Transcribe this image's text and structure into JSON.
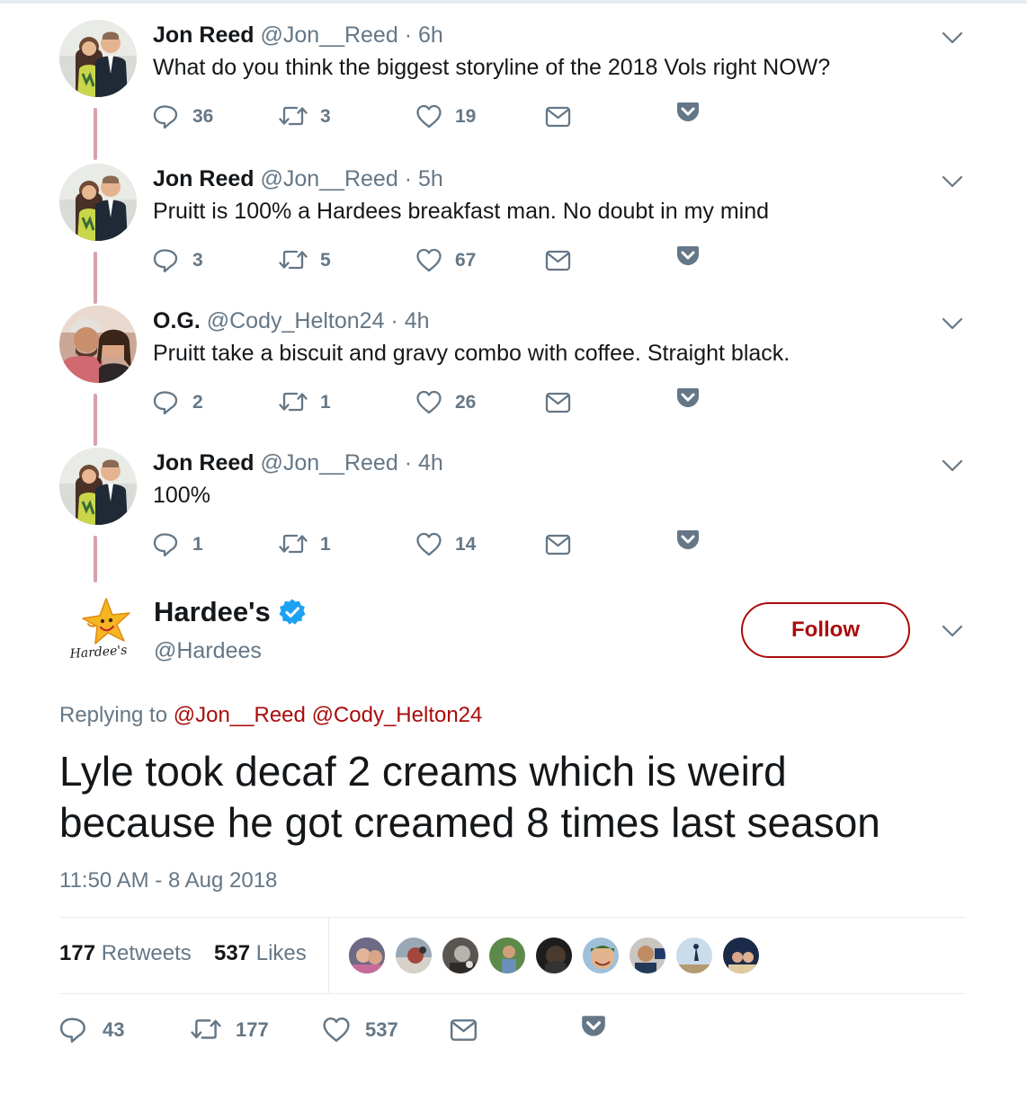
{
  "thread": [
    {
      "name": "Jon Reed",
      "handle": "@Jon__Reed",
      "separator": "·",
      "time": "6h",
      "text": "What do you think the biggest storyline of the 2018 Vols right NOW?",
      "replies": "36",
      "retweets": "3",
      "likes": "19"
    },
    {
      "name": "Jon Reed",
      "handle": "@Jon__Reed",
      "separator": "·",
      "time": "5h",
      "text": "Pruitt is 100% a Hardees breakfast man. No doubt in my mind",
      "replies": "3",
      "retweets": "5",
      "likes": "67"
    },
    {
      "name": "O.G.",
      "handle": "@Cody_Helton24",
      "separator": "·",
      "time": "4h",
      "text": "Pruitt take a biscuit and gravy combo with coffee. Straight black.",
      "replies": "2",
      "retweets": "1",
      "likes": "26"
    },
    {
      "name": "Jon Reed",
      "handle": "@Jon__Reed",
      "separator": "·",
      "time": "4h",
      "text": "100%",
      "replies": "1",
      "retweets": "1",
      "likes": "14"
    }
  ],
  "main": {
    "logo_text": "Hardee's",
    "name": "Hardee's",
    "handle": "@Hardees",
    "follow_label": "Follow",
    "replying_prefix": "Replying to",
    "replying_to_1": "@Jon__Reed",
    "replying_to_2": "@Cody_Helton24",
    "text_line_1": "Lyle took decaf 2 creams which is weird",
    "text_line_2": "because he got creamed 8 times last season",
    "timestamp": "11:50 AM - 8 Aug 2018",
    "retweets_count": "177",
    "retweets_label": "Retweets",
    "likes_count": "537",
    "likes_label": "Likes",
    "replies": "43",
    "retweets": "177",
    "likes": "537"
  },
  "colors": {
    "accent": "#aa0c0c",
    "muted": "#657786",
    "thread_line": "#d4a4a8",
    "verified": "#1da1f2"
  },
  "icons": [
    "reply-icon",
    "retweet-icon",
    "like-icon",
    "direct-message-icon",
    "pocket-icon",
    "chevron-down-icon",
    "verified-badge-icon"
  ]
}
